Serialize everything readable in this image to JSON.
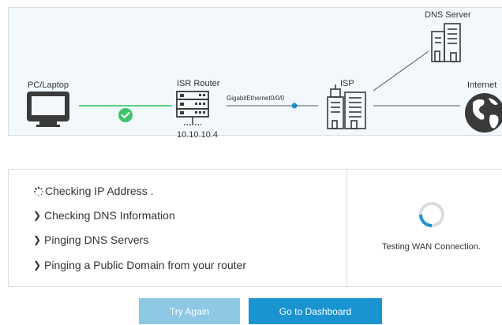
{
  "topology": {
    "nodes": {
      "pc": "PC/Laptop",
      "router": "ISR Router",
      "isp": "ISP",
      "dns": "DNS Server",
      "internet": "Internet"
    },
    "interface": "GigabitEthernet0/0/0",
    "router_ip": "10.10.10.4",
    "link_status": "ok"
  },
  "checks": [
    {
      "label": "Checking IP Address .",
      "state": "in-progress",
      "icon": "loading-dots-icon"
    },
    {
      "label": "Checking DNS Information",
      "state": "pending",
      "icon": "chevron-right-icon"
    },
    {
      "label": "Pinging DNS Servers",
      "state": "pending",
      "icon": "chevron-right-icon"
    },
    {
      "label": "Pinging a Public Domain from your router",
      "state": "pending",
      "icon": "chevron-right-icon"
    }
  ],
  "wan": {
    "status": "Testing WAN Connection."
  },
  "buttons": {
    "try_again": "Try Again",
    "dashboard": "Go to Dashboard"
  },
  "colors": {
    "success": "#41c36c",
    "link": "#1a94d1",
    "spinner": "#1a94d1",
    "button_primary": "#1a94d1",
    "button_disabled": "#8dc8e4"
  }
}
